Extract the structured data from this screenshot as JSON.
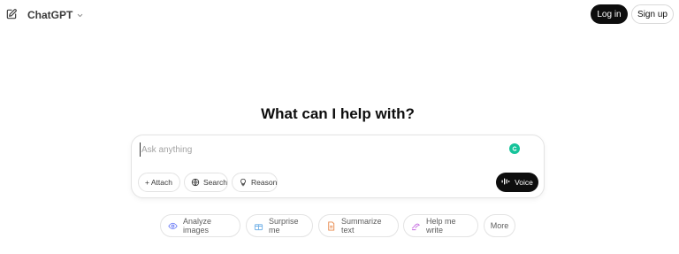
{
  "header": {
    "title": "ChatGPT",
    "new_chat_icon": "edit-icon",
    "login_label": "Log in",
    "signup_label": "Sign up"
  },
  "main": {
    "headline": "What can I help with?"
  },
  "composer": {
    "placeholder": "Ask anything",
    "tools": [
      {
        "label": "+ Attach",
        "icon": "plus-icon"
      },
      {
        "label": "Search",
        "icon": "globe-icon"
      },
      {
        "label": "Reason",
        "icon": "lightbulb-icon"
      }
    ],
    "voice_label": "Voice"
  },
  "suggestions": [
    {
      "label": "Analyze images",
      "icon": "eye-icon",
      "color": "#6b7cf6"
    },
    {
      "label": "Surprise me",
      "icon": "gift-icon",
      "color": "#76b3e8"
    },
    {
      "label": "Summarize text",
      "icon": "document-icon",
      "color": "#e8894b"
    },
    {
      "label": "Help me write",
      "icon": "pen-icon",
      "color": "#c56be0"
    },
    {
      "label": "More"
    }
  ],
  "colors": {
    "primary_button": "#0d0d0d",
    "border": "#e3e3e3",
    "grammarly": "#15c39a"
  }
}
